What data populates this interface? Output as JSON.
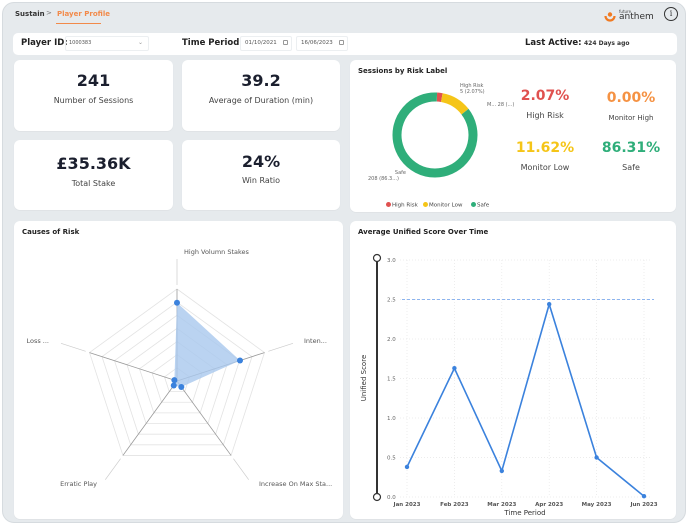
{
  "breadcrumb": {
    "root": "Sustain",
    "separator": ">",
    "current": "Player Profile"
  },
  "brand": {
    "small": "future",
    "name": "anthem",
    "accent_color": "#f07a22"
  },
  "info_icon": "i",
  "filters": {
    "player_id_label": "Player ID:",
    "player_id_value": "1000383",
    "time_period_label": "Time Period",
    "start_date": "01/10/2021",
    "end_date": "16/06/2023",
    "last_active_label": "Last Active:",
    "last_active_value": "424 Days ago"
  },
  "kpis": [
    {
      "value": "241",
      "label": "Number of Sessions"
    },
    {
      "value": "39.2",
      "label": "Average of Duration (min)"
    },
    {
      "value": "£35.36K",
      "label": "Total Stake"
    },
    {
      "value": "24%",
      "label": "Win Ratio"
    }
  ],
  "risk_panel": {
    "title": "Sessions by Risk Label",
    "donut": {
      "segments": [
        {
          "name": "High Risk",
          "count": 5,
          "percent": 2.07,
          "color": "#e0514f",
          "label_line1": "High Risk",
          "label_line2": "5 (2.07%)"
        },
        {
          "name": "Monitor Low",
          "count": 28,
          "percent": 11.62,
          "color": "#f5c518",
          "label_line1": "M... 28 (...)",
          "label_line2": ""
        },
        {
          "name": "Safe",
          "count": 208,
          "percent": 86.31,
          "color": "#2fae7a",
          "label_line1": "Safe",
          "label_line2": "208 (86.3...)"
        }
      ]
    },
    "legend": [
      {
        "label": "High Risk",
        "color": "#e0514f"
      },
      {
        "label": "Monitor Low",
        "color": "#f5c518"
      },
      {
        "label": "Safe",
        "color": "#2fae7a"
      }
    ],
    "stats": [
      {
        "value": "2.07%",
        "label": "High Risk",
        "color": "#e0514f"
      },
      {
        "value": "0.00%",
        "label": "Monitor High",
        "color": "#f59243"
      },
      {
        "value": "11.62%",
        "label": "Monitor Low",
        "color": "#f5c518"
      },
      {
        "value": "86.31%",
        "label": "Safe",
        "color": "#2fae7a"
      }
    ]
  },
  "chart_data": [
    {
      "type": "radar",
      "title": "Causes of Risk",
      "axes": [
        "High Volumn Stakes",
        "Inten...",
        "Increase On Max Sta...",
        "Erratic Play",
        "Loss ..."
      ],
      "values": [
        0.85,
        0.72,
        0.08,
        0.06,
        0.02
      ],
      "range": [
        0,
        1
      ],
      "rings": 7,
      "fill_color": "#a9c8ee",
      "point_color": "#3b82dd"
    },
    {
      "type": "line",
      "title": "Average Unified Score Over Time",
      "xlabel": "Time Period",
      "ylabel": "Unified Score",
      "categories": [
        "Jan 2023",
        "Feb 2023",
        "Mar 2023",
        "Apr 2023",
        "May 2023",
        "Jun 2023"
      ],
      "series": [
        {
          "name": "Unified Score",
          "values": [
            0.38,
            1.63,
            0.33,
            2.44,
            0.5,
            0.01
          ]
        }
      ],
      "ylim": [
        0,
        3.0
      ],
      "yticks": [
        "0.0",
        "0.5",
        "1.0",
        "1.5",
        "2.0",
        "2.5",
        "3.0"
      ],
      "threshold": 2.5,
      "grid": true,
      "line_color": "#3b82dd"
    }
  ]
}
